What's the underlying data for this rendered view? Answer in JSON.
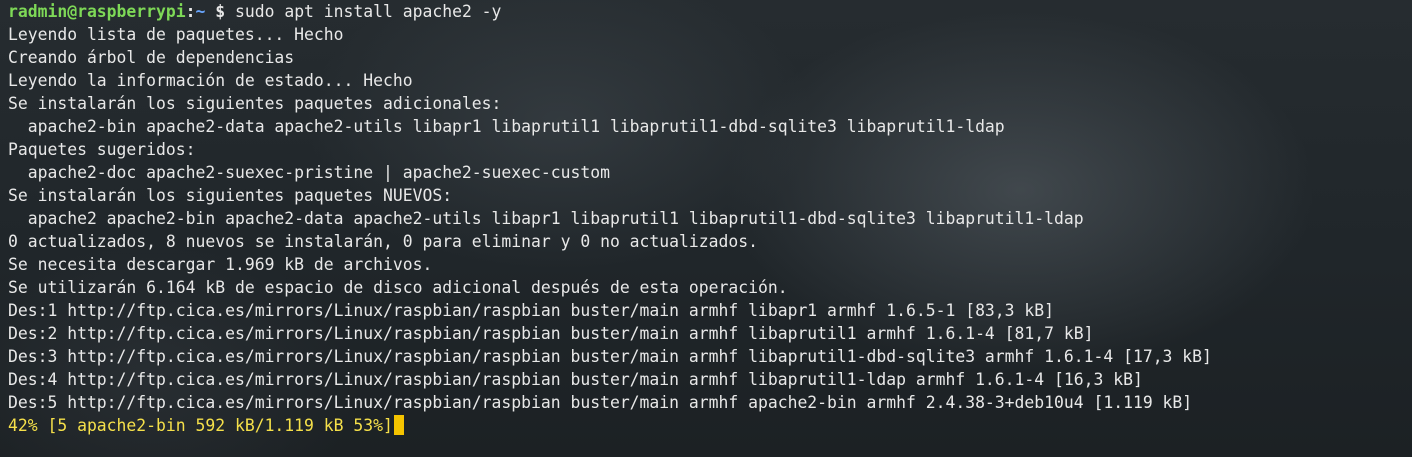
{
  "prompt": {
    "user_host": "radmin@raspberrypi",
    "separator": ":",
    "path": "~",
    "symbol": " $ ",
    "command": "sudo apt install apache2 -y"
  },
  "lines": [
    "Leyendo lista de paquetes... Hecho",
    "Creando árbol de dependencias",
    "Leyendo la información de estado... Hecho",
    "Se instalarán los siguientes paquetes adicionales:",
    "  apache2-bin apache2-data apache2-utils libapr1 libaprutil1 libaprutil1-dbd-sqlite3 libaprutil1-ldap",
    "Paquetes sugeridos:",
    "  apache2-doc apache2-suexec-pristine | apache2-suexec-custom",
    "Se instalarán los siguientes paquetes NUEVOS:",
    "  apache2 apache2-bin apache2-data apache2-utils libapr1 libaprutil1 libaprutil1-dbd-sqlite3 libaprutil1-ldap",
    "0 actualizados, 8 nuevos se instalarán, 0 para eliminar y 0 no actualizados.",
    "Se necesita descargar 1.969 kB de archivos.",
    "Se utilizarán 6.164 kB de espacio de disco adicional después de esta operación.",
    "Des:1 http://ftp.cica.es/mirrors/Linux/raspbian/raspbian buster/main armhf libapr1 armhf 1.6.5-1 [83,3 kB]",
    "Des:2 http://ftp.cica.es/mirrors/Linux/raspbian/raspbian buster/main armhf libaprutil1 armhf 1.6.1-4 [81,7 kB]",
    "Des:3 http://ftp.cica.es/mirrors/Linux/raspbian/raspbian buster/main armhf libaprutil1-dbd-sqlite3 armhf 1.6.1-4 [17,3 kB]",
    "Des:4 http://ftp.cica.es/mirrors/Linux/raspbian/raspbian buster/main armhf libaprutil1-ldap armhf 1.6.1-4 [16,3 kB]",
    "Des:5 http://ftp.cica.es/mirrors/Linux/raspbian/raspbian buster/main armhf apache2-bin armhf 2.4.38-3+deb10u4 [1.119 kB]"
  ],
  "progress_line": "42% [5 apache2-bin 592 kB/1.119 kB 53%]",
  "colors": {
    "prompt_user": "#7ed957",
    "prompt_path": "#6aa7ff",
    "text": "#e8e8e8",
    "progress": "#f5e04a",
    "cursor": "#f5c400"
  }
}
